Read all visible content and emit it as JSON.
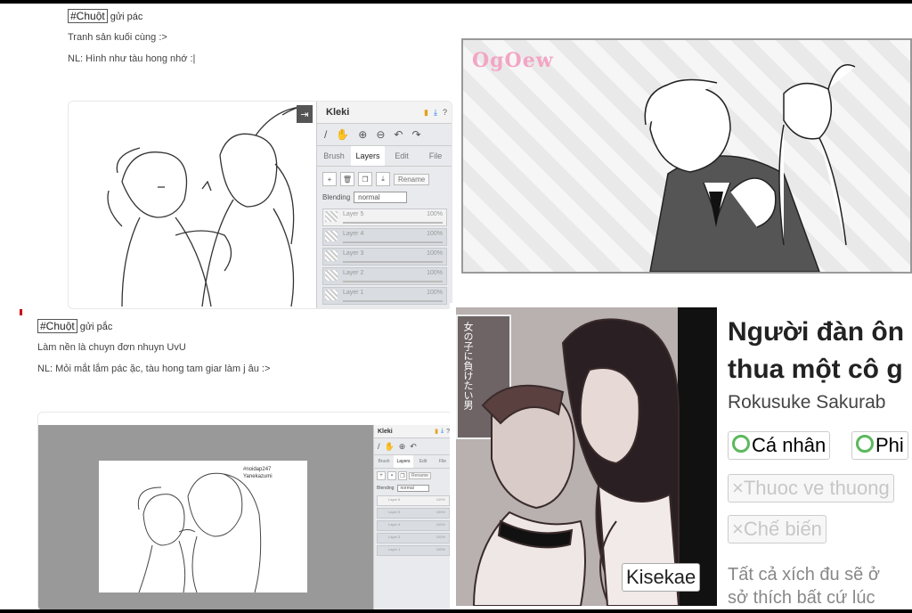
{
  "post1": {
    "tag": "#Chuột",
    "tag_suffix": "gửi pác",
    "line1": "Tranh sản kuối cùng :>",
    "line2": "NL: Hình như tàu hong nhớ :|"
  },
  "post2": {
    "tag": "#Chuột",
    "tag_suffix": "gửi pắc",
    "line1": "Làm nền là chuyn đơn nhuyn UvU",
    "line2": "NL: Mỏi mắt lắm pác ặc, tàu hong tam giar làm j âu :>"
  },
  "kleki1": {
    "app": "Kleki",
    "tabs": [
      "Brush",
      "Layers",
      "Edit",
      "File"
    ],
    "rename": "Rename",
    "blending_label": "Blending",
    "blending_value": "normal",
    "layers": [
      {
        "name": "Layer 5",
        "pct": "100%"
      },
      {
        "name": "Layer 4",
        "pct": "100%"
      },
      {
        "name": "Layer 3",
        "pct": "100%"
      },
      {
        "name": "Layer 2",
        "pct": "100%"
      },
      {
        "name": "Layer 1",
        "pct": "100%"
      }
    ]
  },
  "kleki2": {
    "app": "Kleki",
    "tabs": [
      "Brush",
      "Layers",
      "Edit",
      "File"
    ],
    "rename": "Rename",
    "blending_label": "Blending",
    "blending_value": "normal",
    "layers": [
      {
        "name": "Layer 6",
        "pct": "100%"
      },
      {
        "name": "Layer 5",
        "pct": "100%"
      },
      {
        "name": "Layer 4",
        "pct": "100%"
      },
      {
        "name": "Layer 3",
        "pct": "100%"
      },
      {
        "name": "Layer 1",
        "pct": "100%"
      }
    ]
  },
  "canvas2_caption": "#noidap247\nYanekazumi",
  "watermark": "OgOew",
  "manga": {
    "badge": "Kisekae",
    "title_line1": "Người đàn ôn",
    "title_line2": "thua một cô g",
    "author": "Rokusuke Sakurab",
    "chips": [
      {
        "label": "Cá nhân",
        "ring": true
      },
      {
        "label": "Phi",
        "ring": true
      }
    ],
    "chips_muted": [
      "×Thuoc ve thuong",
      "×Chế biến"
    ],
    "desc": "Tất cả xích đu sẽ ở\nsở thích bất cứ lúc",
    "cover_jp": "女の子に負けたい男"
  }
}
